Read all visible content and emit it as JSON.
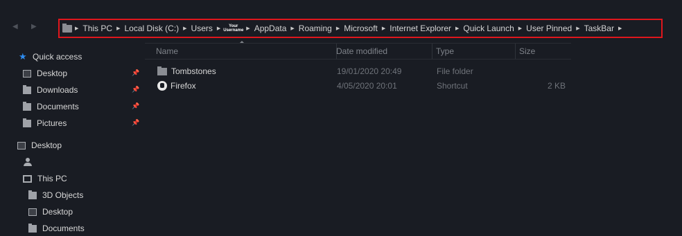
{
  "nav": {
    "back_icon": "back-arrow-icon",
    "forward_icon": "forward-arrow-icon"
  },
  "breadcrumb": {
    "items": [
      "This PC",
      "Local Disk (C:)",
      "Users",
      "AppData",
      "Roaming",
      "Microsoft",
      "Internet Explorer",
      "Quick Launch",
      "User Pinned",
      "TaskBar"
    ],
    "username_line1": "Your",
    "username_line2": "Username",
    "highlight_color": "#e0161c"
  },
  "sidebar": {
    "quick_access": "Quick access",
    "pinned": [
      "Desktop",
      "Downloads",
      "Documents",
      "Pictures"
    ],
    "desktop": "Desktop",
    "this_pc": "This PC",
    "this_pc_children": [
      "3D Objects",
      "Desktop",
      "Documents"
    ],
    "accent": "#2e8cf0"
  },
  "columns": {
    "name": "Name",
    "date": "Date modified",
    "type": "Type",
    "size": "Size"
  },
  "files": [
    {
      "name": "Tombstones",
      "date": "19/01/2020 20:49",
      "type": "File folder",
      "size": "",
      "icon": "folder-icon"
    },
    {
      "name": "Firefox",
      "date": "4/05/2020 20:01",
      "type": "Shortcut",
      "size": "2 KB",
      "icon": "firefox-icon"
    }
  ]
}
